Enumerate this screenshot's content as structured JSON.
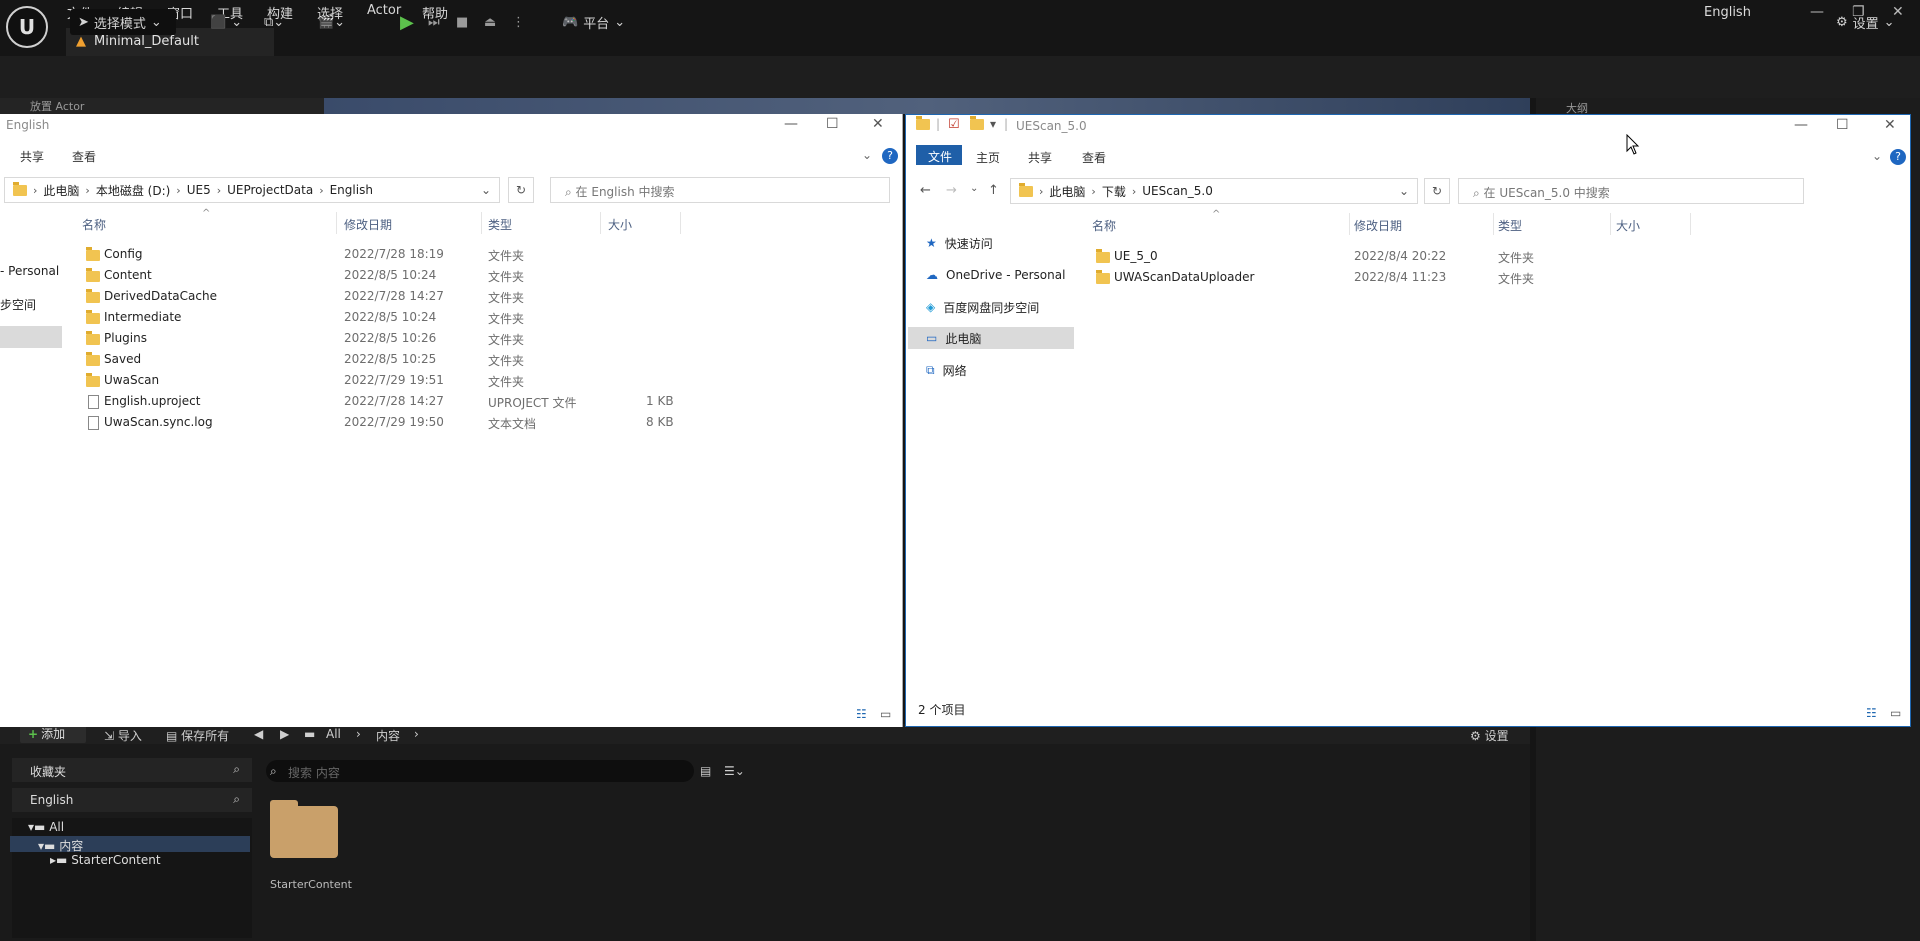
{
  "ue": {
    "logo": "U",
    "menus": [
      "文件",
      "编辑",
      "窗口",
      "工具",
      "构建",
      "选择",
      "Actor",
      "帮助"
    ],
    "language": "English",
    "project_tab": "Minimal_Default",
    "select_mode": "选择模式",
    "platform": "平台",
    "settings": "设置",
    "left_panel_header": "放置 Actor",
    "right_panel_header": "大纲"
  },
  "content_browser": {
    "add": "添加",
    "import": "导入",
    "save_all": "保存所有",
    "path_root": "All",
    "path_current": "内容",
    "settings": "设置",
    "favorites": "收藏夹",
    "project": "English",
    "search_placeholder": "搜索 内容",
    "tree": [
      "All",
      "内容",
      "StarterContent"
    ],
    "folder_label": "StarterContent"
  },
  "left_explorer": {
    "title": "English",
    "ribbon": [
      "共享",
      "查看"
    ],
    "path": [
      "此电脑",
      "本地磁盘 (D:)",
      "UE5",
      "UEProjectData",
      "English"
    ],
    "search_placeholder": "在 English 中搜索",
    "columns": [
      "名称",
      "修改日期",
      "类型",
      "大小"
    ],
    "nav_partial": [
      "- Personal",
      "步空间"
    ],
    "rows": [
      {
        "name": "Config",
        "date": "2022/7/28 18:19",
        "type": "文件夹",
        "size": "",
        "icon": "folder-icon"
      },
      {
        "name": "Content",
        "date": "2022/8/5 10:24",
        "type": "文件夹",
        "size": "",
        "icon": "folder-icon"
      },
      {
        "name": "DerivedDataCache",
        "date": "2022/7/28 14:27",
        "type": "文件夹",
        "size": "",
        "icon": "folder-icon"
      },
      {
        "name": "Intermediate",
        "date": "2022/8/5 10:24",
        "type": "文件夹",
        "size": "",
        "icon": "folder-icon"
      },
      {
        "name": "Plugins",
        "date": "2022/8/5 10:26",
        "type": "文件夹",
        "size": "",
        "icon": "folder-icon"
      },
      {
        "name": "Saved",
        "date": "2022/8/5 10:25",
        "type": "文件夹",
        "size": "",
        "icon": "folder-icon"
      },
      {
        "name": "UwaScan",
        "date": "2022/7/29 19:51",
        "type": "文件夹",
        "size": "",
        "icon": "folder-icon"
      },
      {
        "name": "English.uproject",
        "date": "2022/7/28 14:27",
        "type": "UPROJECT 文件",
        "size": "1 KB",
        "icon": "file-icon"
      },
      {
        "name": "UwaScan.sync.log",
        "date": "2022/7/29 19:50",
        "type": "文本文档",
        "size": "8 KB",
        "icon": "file-icon"
      }
    ]
  },
  "right_explorer": {
    "title": "UEScan_5.0",
    "ribbon_file": "文件",
    "ribbon": [
      "主页",
      "共享",
      "查看"
    ],
    "path": [
      "此电脑",
      "下载",
      "UEScan_5.0"
    ],
    "search_placeholder": "在 UEScan_5.0 中搜索",
    "columns": [
      "名称",
      "修改日期",
      "类型",
      "大小"
    ],
    "nav": [
      {
        "label": "快速访问",
        "icon": "star-icon"
      },
      {
        "label": "OneDrive - Personal",
        "icon": "cloud-icon"
      },
      {
        "label": "百度网盘同步空间",
        "icon": "baidu-icon"
      },
      {
        "label": "此电脑",
        "icon": "computer-icon"
      },
      {
        "label": "网络",
        "icon": "network-icon"
      }
    ],
    "rows": [
      {
        "name": "UE_5_0",
        "date": "2022/8/4 20:22",
        "type": "文件夹"
      },
      {
        "name": "UWAScanDataUploader",
        "date": "2022/8/4 11:23",
        "type": "文件夹"
      }
    ],
    "status": "2 个项目"
  }
}
